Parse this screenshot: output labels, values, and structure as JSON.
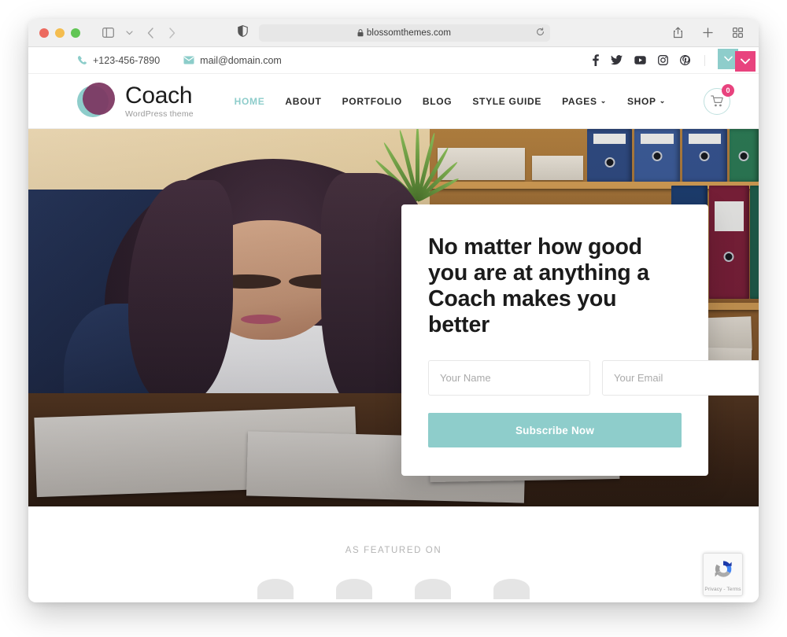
{
  "browser": {
    "url": "blossomthemes.com",
    "lock_icon": "lock-icon",
    "reload_icon": "reload-icon",
    "shield_icon": "shield-icon",
    "sidebar_icon": "sidebar-toggle-icon",
    "back_icon": "back-arrow-icon",
    "forward_icon": "forward-arrow-icon",
    "share_icon": "share-icon",
    "new_tab_icon": "plus-icon",
    "tab_overview_icon": "tab-overview-icon",
    "traffic_lights": [
      "close",
      "minimize",
      "maximize"
    ]
  },
  "topbar": {
    "phone": "+123-456-7890",
    "email": "mail@domain.com",
    "phone_icon": "phone-icon",
    "email_icon": "envelope-icon",
    "socials": [
      {
        "name": "facebook",
        "label": "f"
      },
      {
        "name": "twitter",
        "label": "t"
      },
      {
        "name": "youtube",
        "label": "y"
      },
      {
        "name": "instagram",
        "label": "i"
      },
      {
        "name": "pinterest",
        "label": "p"
      }
    ],
    "search_icon": "search-icon",
    "corner_badge_teal": "chevron-down-icon",
    "corner_badge_pink": "chevron-down-icon"
  },
  "header": {
    "logo_title": "Coach",
    "logo_subtitle": "WordPress theme",
    "nav": [
      {
        "label": "HOME",
        "active": true,
        "caret": ""
      },
      {
        "label": "ABOUT",
        "active": false,
        "caret": ""
      },
      {
        "label": "PORTFOLIO",
        "active": false,
        "caret": ""
      },
      {
        "label": "BLOG",
        "active": false,
        "caret": ""
      },
      {
        "label": "STYLE GUIDE",
        "active": false,
        "caret": ""
      },
      {
        "label": "PAGES",
        "active": false,
        "caret": "⌄"
      },
      {
        "label": "SHOP",
        "active": false,
        "caret": "⌄"
      }
    ],
    "cart_icon": "cart-icon",
    "cart_count": "0"
  },
  "hero": {
    "title": "No matter how good you are at anything a Coach makes you better",
    "name_placeholder": "Your Name",
    "name_value": "",
    "email_placeholder": "Your Email",
    "email_value": "",
    "submit_label": "Subscribe Now"
  },
  "featured": {
    "label": "AS FEATURED ON"
  },
  "recaptcha": {
    "icon": "recaptcha-icon",
    "terms": "Privacy - Terms"
  },
  "colors": {
    "accent_teal": "#8ecdcb",
    "accent_pink": "#e8437e",
    "logo_purple": "#7c3560",
    "text_dark": "#1b1b1b",
    "muted": "#b4b4b4"
  }
}
